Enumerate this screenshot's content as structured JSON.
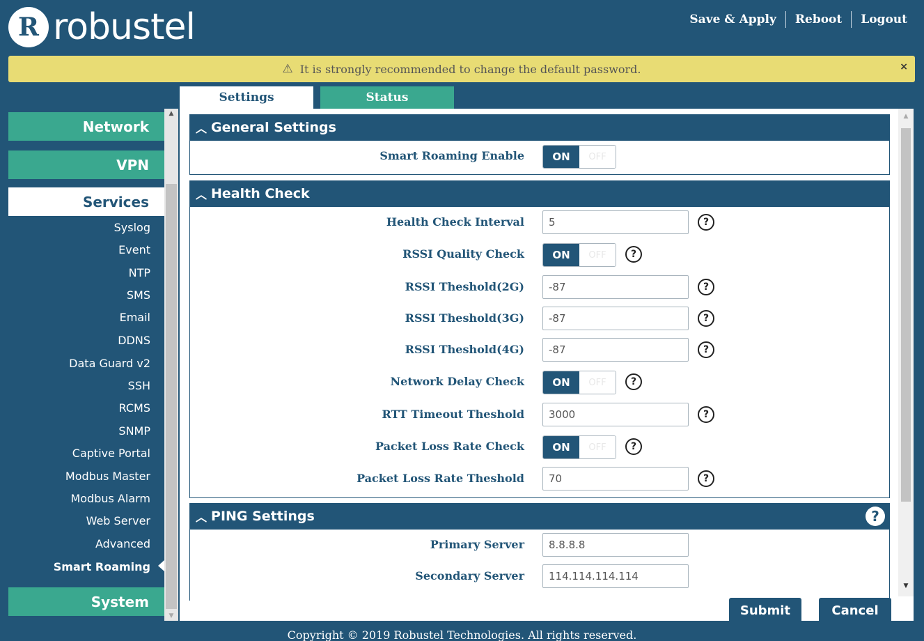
{
  "header": {
    "logo_mark": "R",
    "logo_text": "robustel",
    "nav": [
      "Save & Apply",
      "Reboot",
      "Logout"
    ]
  },
  "alert": {
    "icon": "warning-triangle-icon",
    "text": "It is strongly recommended to change the default password.",
    "close": "×"
  },
  "tabs": [
    "Settings",
    "Status"
  ],
  "sidebar": {
    "network": "Network",
    "vpn": "VPN",
    "services": "Services",
    "service_items": [
      "Syslog",
      "Event",
      "NTP",
      "SMS",
      "Email",
      "DDNS",
      "Data Guard v2",
      "SSH",
      "RCMS",
      "SNMP",
      "Captive Portal",
      "Modbus Master",
      "Modbus Alarm",
      "Web Server",
      "Advanced",
      "Smart Roaming"
    ],
    "current_item": "Smart Roaming",
    "system": "System"
  },
  "toggle": {
    "on": "ON",
    "off": "OFF"
  },
  "help_glyph": "?",
  "general": {
    "title": "General Settings",
    "smart_roaming_enable": {
      "label": "Smart Roaming Enable",
      "value": "ON"
    }
  },
  "health": {
    "title": "Health Check",
    "interval": {
      "label": "Health Check Interval",
      "value": "5"
    },
    "rssi_check": {
      "label": "RSSI Quality Check",
      "value": "ON"
    },
    "rssi_2g": {
      "label": "RSSI Theshold(2G)",
      "value": "-87"
    },
    "rssi_3g": {
      "label": "RSSI Theshold(3G)",
      "value": "-87"
    },
    "rssi_4g": {
      "label": "RSSI Theshold(4G)",
      "value": "-87"
    },
    "delay_check": {
      "label": "Network Delay Check",
      "value": "ON"
    },
    "rtt_timeout": {
      "label": "RTT Timeout Theshold",
      "value": "3000"
    },
    "loss_check": {
      "label": "Packet Loss Rate Check",
      "value": "ON"
    },
    "loss_threshold": {
      "label": "Packet Loss Rate Theshold",
      "value": "70"
    }
  },
  "ping": {
    "title": "PING Settings",
    "primary": {
      "label": "Primary Server",
      "value": "8.8.8.8"
    },
    "secondary": {
      "label": "Secondary Server",
      "value": "114.114.114.114"
    }
  },
  "buttons": {
    "submit": "Submit",
    "cancel": "Cancel"
  },
  "footer": "Copyright © 2019 Robustel Technologies. All rights reserved."
}
